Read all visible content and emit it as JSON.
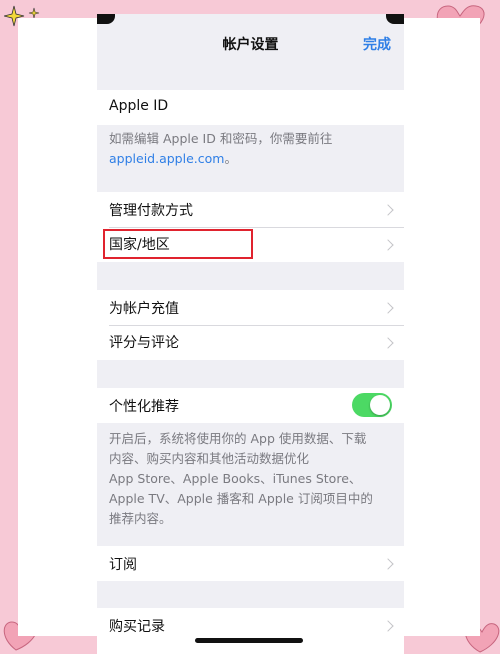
{
  "navbar": {
    "title": "帐户设置",
    "done_label": "完成"
  },
  "apple_id": {
    "label": "Apple ID",
    "footer_line1": "如需编辑 Apple ID 和密码，你需要前往",
    "footer_link": "appleid.apple.com",
    "footer_end": "。"
  },
  "group1": {
    "items": [
      "管理付款方式",
      "国家/地区"
    ]
  },
  "group2": {
    "items": [
      "为帐户充值",
      "评分与评论"
    ]
  },
  "personalized": {
    "label": "个性化推荐",
    "enabled": true,
    "footer_lines": [
      "开启后，系统将使用你的 App 使用数据、下载",
      "内容、购买内容和其他活动数据优化",
      "App Store、Apple Books、iTunes Store、",
      "Apple TV、Apple 播客和 Apple 订阅项目中的",
      "推荐内容。"
    ]
  },
  "subscriptions": {
    "label": "订阅"
  },
  "purchase_history": {
    "label": "购买记录"
  },
  "colors": {
    "accent": "#2f7fe6",
    "toggle_on": "#4cd964",
    "highlight": "#e0232e",
    "background": "#f7c9d6"
  }
}
